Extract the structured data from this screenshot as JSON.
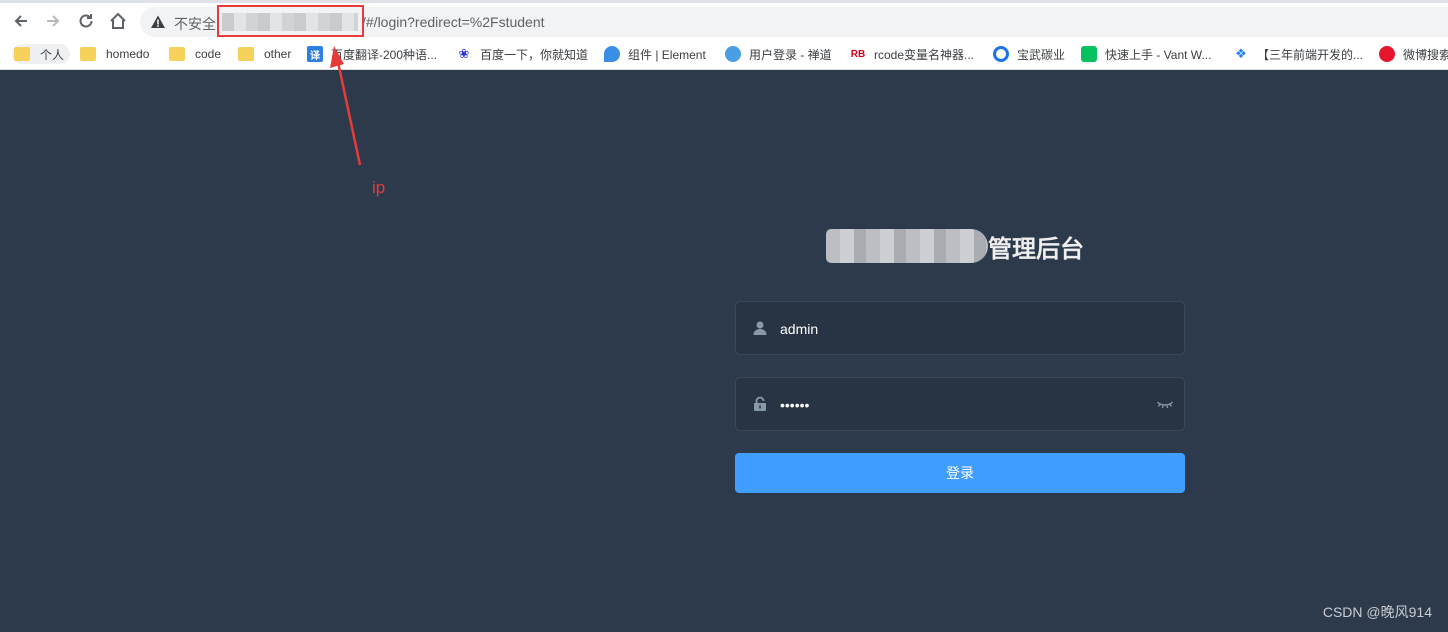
{
  "browser": {
    "insecure_label": "不安全",
    "url_path": "/#/login?redirect=%2Fstudent",
    "bookmarks": [
      {
        "label": "个人",
        "icon": "folder-icon"
      },
      {
        "label": "homedo",
        "icon": "folder-icon"
      },
      {
        "label": "code",
        "icon": "folder-icon"
      },
      {
        "label": "other",
        "icon": "folder-icon"
      },
      {
        "label": "百度翻译-200种语...",
        "icon": "baidu-fanyi-icon",
        "glyph": "译"
      },
      {
        "label": "百度一下，你就知道",
        "icon": "baidu-icon"
      },
      {
        "label": "组件 | Element",
        "icon": "element-icon"
      },
      {
        "label": "用户登录 - 禅道",
        "icon": "chandao-icon"
      },
      {
        "label": "rcode变量名神器...",
        "icon": "rb-icon",
        "glyph": "RB"
      },
      {
        "label": "宝武碳业",
        "icon": "baowu-icon"
      },
      {
        "label": "快速上手 - Vant W...",
        "icon": "vant-icon"
      },
      {
        "label": "【三年前端开发的...",
        "icon": "juejin-icon"
      },
      {
        "label": "微博搜索",
        "icon": "weibo-icon"
      }
    ]
  },
  "annotation": {
    "label": "ip",
    "color": "#e63b3b"
  },
  "login": {
    "title_suffix": "管理后台",
    "username": "admin",
    "password": "111111",
    "button_label": "登录"
  },
  "watermark": "CSDN @晚风914",
  "colors": {
    "background": "#2d3a4b",
    "field_bg": "#283443",
    "button": "#409eff"
  }
}
